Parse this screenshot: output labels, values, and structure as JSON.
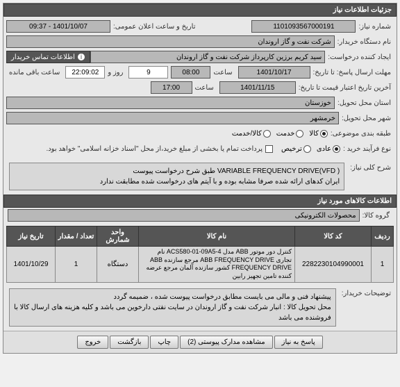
{
  "title_bar": "جزئیات اطلاعات نیاز",
  "labels": {
    "order_no": "شماره نیاز:",
    "org": "نام دستگاه خریدار:",
    "requester": "ایجاد کننده درخواست:",
    "contact_btn": "اطلاعات تماس خریدار",
    "deadline": "مهلت ارسال پاسخ: تا تاریخ:",
    "hour": "ساعت",
    "day_and": "روز و",
    "remain": "ساعت باقی مانده",
    "validity": "آخرین تاریخ اعتبار قیمت تا تاریخ:",
    "province": "استان محل تحویل:",
    "city": "شهر محل تحویل:",
    "classify": "طبقه بندی موضوعی:",
    "process": "نوع فرآیند خرید :",
    "announce": "تاریخ و ساعت اعلان عمومی:",
    "proc_a": "عادی",
    "proc_b": "ترخیص",
    "cls_a": "کالا",
    "cls_b": "خدمت",
    "cls_c": "کالا/خدمت",
    "pay_note": "پرداخت تمام یا بخشی از مبلغ خرید،از محل \"اسناد خزانه اسلامی\" خواهد بود.",
    "desc_label": "شرح کلی نیاز:",
    "items_header": "اطلاعات کالاهای مورد نیاز",
    "group_label": "گروه کالا:",
    "buyer_notes_label": "توضیحات خریدار:"
  },
  "values": {
    "order_no": "1101093567000191",
    "org": "شرکت نفت و گاز اروندان",
    "requester": "سید کریم برزین کارپرداز شرکت نفت و گاز اروندان",
    "deadline_date": "1401/10/17",
    "deadline_time": "08:00",
    "days_left": "9",
    "hours_left": "22:09:02",
    "valid_date": "1401/11/15",
    "valid_time": "17:00",
    "province": "خوزستان",
    "city": "خرمشهر",
    "announce": "1401/10/07 - 09:37",
    "group": "محصولات الکترونیکی"
  },
  "desc": {
    "l1": "VARIABLE FREQUENCY DRIVE(VFD ) طبق شرح درخواست پیوست",
    "l2": "ایران کدهای ارائه شده صرفا مشابه بوده و با آیتم های درخواست شده مطابقت ندارد"
  },
  "table": {
    "headers": {
      "row": "ردیف",
      "code": "کد کالا",
      "name": "نام کالا",
      "unit": "واحد شمارش",
      "qty": "تعداد / مقدار",
      "date": "تاریخ نیاز"
    },
    "rows": [
      {
        "row": "1",
        "code": "2282230104990001",
        "name": "کنترل دور موتور ABB مدل ACS580-01-09A5-4 نام تجاری ABB FREQUENCY DRIVE مرجع سازنده ABB FREQUENCY DRIVE کشور سازنده آلمان مرجع عرضه کننده تامین تجهیز رابین",
        "unit": "دستگاه",
        "qty": "1",
        "date": "1401/10/29"
      }
    ]
  },
  "buyer_notes": {
    "l1": "پیشنهاد فنی و مالی می بایست مطابق درخواست پیوست شده ، ضمیمه گردد",
    "l2": "محل تحویل کالا : انبار شرکت نفت و گاز اروندان در سایت نفتی دارخوین می باشد و کلیه هزینه های ارسال کالا با فروشنده می باشد"
  },
  "buttons": {
    "reply": "پاسخ به نیاز",
    "attach": "مشاهده مدارک پیوستی (2)",
    "print": "چاپ",
    "back": "بازگشت",
    "exit": "خروج"
  }
}
